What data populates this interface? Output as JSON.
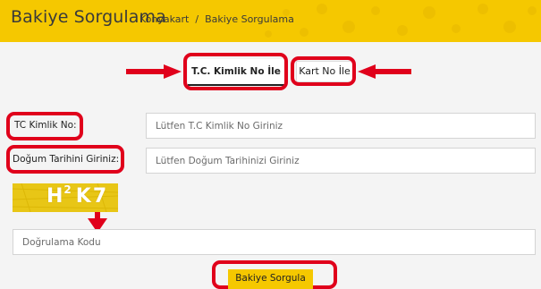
{
  "header": {
    "title": "Bakiye Sorgulama",
    "breadcrumb": [
      {
        "label": "Konyakart"
      },
      {
        "label": "Bakiye Sorgulama"
      }
    ],
    "separator": "/"
  },
  "tabs": [
    {
      "label": "T.C. Kimlik No İle",
      "selected": true
    },
    {
      "label": "Kart No İle",
      "selected": false
    }
  ],
  "form": {
    "tc_label": "TC Kimlik No:",
    "tc_placeholder": "Lütfen T.C Kimlik No Giriniz",
    "dob_label": "Doğum Tarihini Giriniz:",
    "dob_placeholder": "Lütfen Doğum Tarihinizi Giriniz",
    "captcha_text": "H²K7",
    "captcha_main1": "H",
    "captcha_sup": "2",
    "captcha_main2": "K7",
    "verify_placeholder": "Doğrulama Kodu",
    "submit_label": "Bakiye Sorgula"
  },
  "colors": {
    "brand": "#f5c800",
    "annotation": "#e0001b"
  }
}
